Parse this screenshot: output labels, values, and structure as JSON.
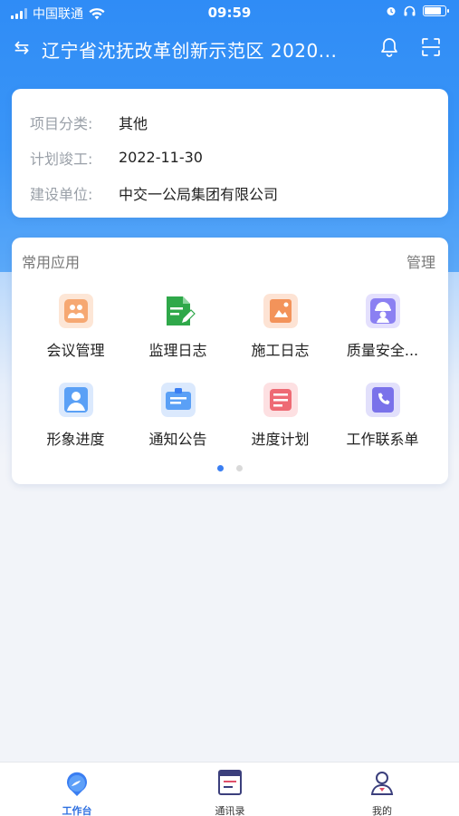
{
  "status": {
    "carrier": "中国联通",
    "time": "09:59"
  },
  "nav": {
    "title": "辽宁省沈抚改革创新示范区 2020..."
  },
  "project": {
    "rows": [
      {
        "key": "项目分类:",
        "value": "其他"
      },
      {
        "key": "计划竣工:",
        "value": "2022-11-30"
      },
      {
        "key": "建设单位:",
        "value": "中交一公局集团有限公司"
      }
    ]
  },
  "apps": {
    "title": "常用应用",
    "manage": "管理",
    "items": [
      {
        "label": "会议管理",
        "icon": "meeting-icon",
        "color": "#f0863a"
      },
      {
        "label": "监理日志",
        "icon": "supervision-log-icon",
        "color": "#2fa84a"
      },
      {
        "label": "施工日志",
        "icon": "construction-log-icon",
        "color": "#f07a3a"
      },
      {
        "label": "质量安全...",
        "icon": "quality-safety-icon",
        "color": "#7a6df0"
      },
      {
        "label": "形象进度",
        "icon": "image-progress-icon",
        "color": "#3a8ef2"
      },
      {
        "label": "通知公告",
        "icon": "notice-icon",
        "color": "#3a8ef2"
      },
      {
        "label": "进度计划",
        "icon": "schedule-plan-icon",
        "color": "#e8505b"
      },
      {
        "label": "工作联系单",
        "icon": "contact-sheet-icon",
        "color": "#6a62e6"
      }
    ],
    "page_dots": {
      "total": 2,
      "active": 1
    }
  },
  "tabs": [
    {
      "label": "工作台",
      "icon": "workbench-icon",
      "active": true
    },
    {
      "label": "通讯录",
      "icon": "contacts-icon",
      "active": false
    },
    {
      "label": "我的",
      "icon": "profile-icon",
      "active": false
    }
  ]
}
